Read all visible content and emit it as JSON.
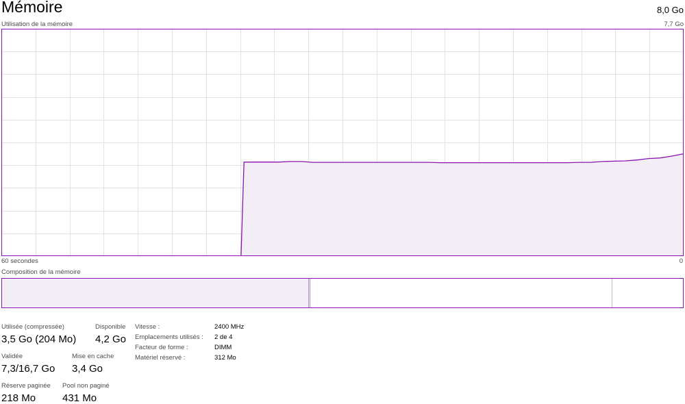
{
  "header": {
    "title": "Mémoire",
    "total": "8,0 Go",
    "usage_label": "Utilisation de la mémoire",
    "usage_max": "7,7 Go"
  },
  "graph": {
    "left_axis_label": "60 secondes",
    "right_axis_label": "0",
    "line_color": "#8b12ae",
    "fill_color": "#f3eef5",
    "grid_color": "#e6dfe9",
    "max_value_go": 7.7,
    "usage_series_go": [
      0,
      0,
      0,
      0,
      0,
      0,
      0,
      0,
      0,
      0,
      0,
      0,
      0,
      0,
      0,
      0,
      0,
      0,
      0,
      0,
      0,
      3.18,
      3.18,
      3.18,
      3.18,
      3.2,
      3.2,
      3.17,
      3.17,
      3.17,
      3.17,
      3.17,
      3.17,
      3.17,
      3.17,
      3.17,
      3.17,
      3.17,
      3.16,
      3.16,
      3.16,
      3.16,
      3.16,
      3.16,
      3.16,
      3.16,
      3.16,
      3.16,
      3.16,
      3.16,
      3.17,
      3.17,
      3.2,
      3.21,
      3.22,
      3.25,
      3.3,
      3.32,
      3.38,
      3.46
    ]
  },
  "composition": {
    "label": "Composition de la mémoire",
    "in_use_fraction": 0.451,
    "modified_fraction": 0.002,
    "standby_fraction": 0.443
  },
  "stats": {
    "used_label": "Utilisée (compressée)",
    "used_value": "3,5 Go (204 Mo)",
    "available_label": "Disponible",
    "available_value": "4,2 Go",
    "committed_label": "Validée",
    "committed_value": "7,3/16,7 Go",
    "cached_label": "Mise en cache",
    "cached_value": "3,4 Go",
    "paged_label": "Réserve paginée",
    "paged_value": "218 Mo",
    "nonpaged_label": "Pool non paginé",
    "nonpaged_value": "431 Mo"
  },
  "specs": {
    "speed_label": "Vitesse :",
    "speed_value": "2400 MHz",
    "slots_label": "Emplacements utilisés :",
    "slots_value": "2 de 4",
    "form_label": "Facteur de forme :",
    "form_value": "DIMM",
    "reserved_label": "Matériel réservé :",
    "reserved_value": "312 Mo"
  }
}
